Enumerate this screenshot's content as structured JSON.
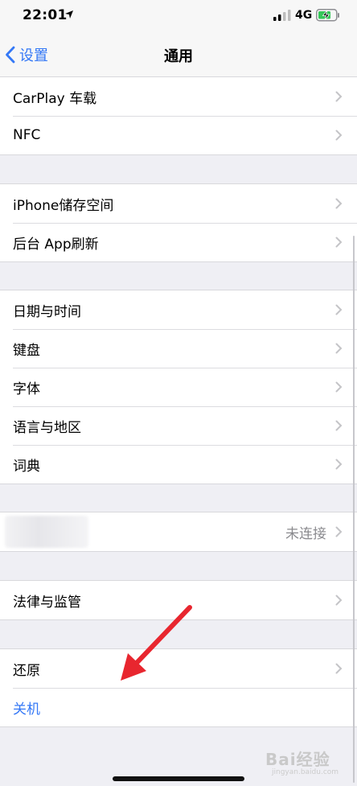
{
  "status": {
    "time": "22:01",
    "network": "4G"
  },
  "nav": {
    "back_label": "设置",
    "title": "通用"
  },
  "groups": {
    "g1": [
      {
        "label": "CarPlay 车载"
      },
      {
        "label": "NFC"
      }
    ],
    "g2": [
      {
        "label": "iPhone储存空间"
      },
      {
        "label": "后台 App刷新"
      }
    ],
    "g3": [
      {
        "label": "日期与时间"
      },
      {
        "label": "键盘"
      },
      {
        "label": "字体"
      },
      {
        "label": "语言与地区"
      },
      {
        "label": "词典"
      }
    ],
    "g4": [
      {
        "value": "未连接"
      }
    ],
    "g5": [
      {
        "label": "法律与监管"
      }
    ],
    "g6": [
      {
        "label": "还原"
      },
      {
        "label": "关机"
      }
    ]
  },
  "colors": {
    "accent": "#3478f6",
    "arrow": "#e8262f",
    "battery": "#35c759"
  },
  "watermark": {
    "brand": "Bai经验",
    "sub": "jingyan.baidu.com"
  }
}
